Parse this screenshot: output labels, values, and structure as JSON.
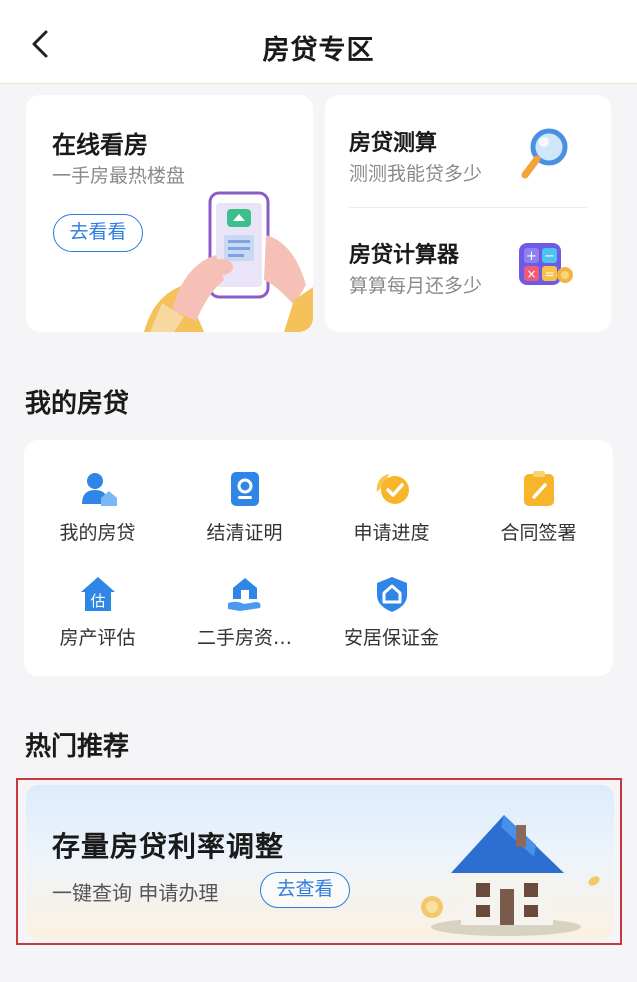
{
  "header": {
    "title": "房贷专区",
    "back_icon": "chevron-left-icon"
  },
  "online_card": {
    "title": "在线看房",
    "subtitle": "一手房最热楼盘",
    "button": "去看看",
    "illustration": "phone-in-hands-illustration"
  },
  "tools": [
    {
      "title": "房贷测算",
      "subtitle": "测测我能贷多少",
      "icon": "magnifier-icon"
    },
    {
      "title": "房贷计算器",
      "subtitle": "算算每月还多少",
      "icon": "calculator-icon"
    }
  ],
  "my_loan": {
    "title": "我的房贷",
    "items": [
      {
        "label": "我的房贷",
        "icon": "user-house-icon"
      },
      {
        "label": "结清证明",
        "icon": "certificate-icon"
      },
      {
        "label": "申请进度",
        "icon": "check-progress-icon"
      },
      {
        "label": "合同签署",
        "icon": "clipboard-sign-icon"
      },
      {
        "label": "房产评估",
        "icon": "house-evaluate-icon"
      },
      {
        "label": "二手房资…",
        "icon": "house-hand-icon"
      },
      {
        "label": "安居保证金",
        "icon": "shield-house-icon"
      }
    ]
  },
  "hot": {
    "title": "热门推荐",
    "banner": {
      "title": "存量房贷利率调整",
      "subtitle": "一键查询 申请办理",
      "button": "去查看",
      "illustration": "house-illustration"
    }
  },
  "colors": {
    "accent": "#2f7be0",
    "highlight_border": "#c9383f",
    "icon_blue": "#2f86e6",
    "icon_yellow": "#f7b62a"
  }
}
